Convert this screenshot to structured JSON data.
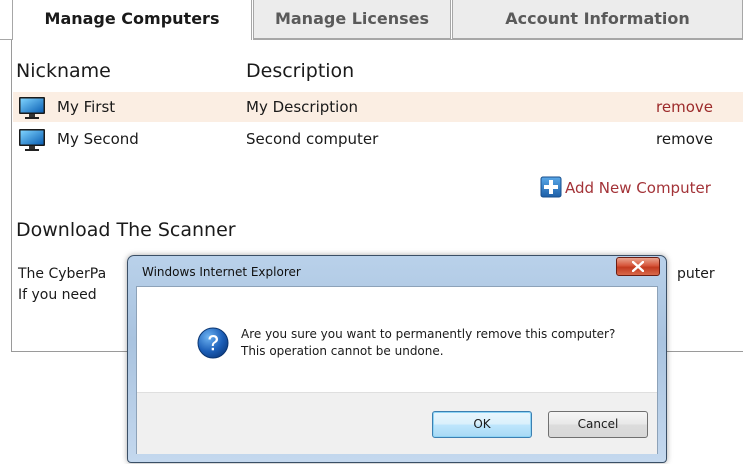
{
  "tabs": [
    {
      "label": "Manage Computers",
      "active": true
    },
    {
      "label": "Manage Licenses",
      "active": false
    },
    {
      "label": "Account Information",
      "active": false
    }
  ],
  "computers_table": {
    "headers": {
      "nickname": "Nickname",
      "description": "Description"
    },
    "rows": [
      {
        "nickname": "My First",
        "description": "My Description",
        "action": "remove",
        "highlighted": true
      },
      {
        "nickname": "My Second",
        "description": "Second computer",
        "action": "remove",
        "highlighted": false
      }
    ],
    "icon": "monitor-icon"
  },
  "add_computer": {
    "label": "Add New Computer",
    "icon": "plus-icon"
  },
  "download_section": {
    "title": "Download The Scanner",
    "line1": "The CyberPa",
    "line1_tail": "puter",
    "line2": "If you need"
  },
  "dialog": {
    "title": "Windows Internet Explorer",
    "message_line1": "Are you sure you want to permanently remove this computer?",
    "message_line2": "This operation cannot be undone.",
    "ok_label": "OK",
    "cancel_label": "Cancel",
    "icon": "question-icon"
  },
  "colors": {
    "link_red": "#a33338",
    "row_highlight": "#fbeee3",
    "dialog_frame": "#b9d1ea"
  }
}
